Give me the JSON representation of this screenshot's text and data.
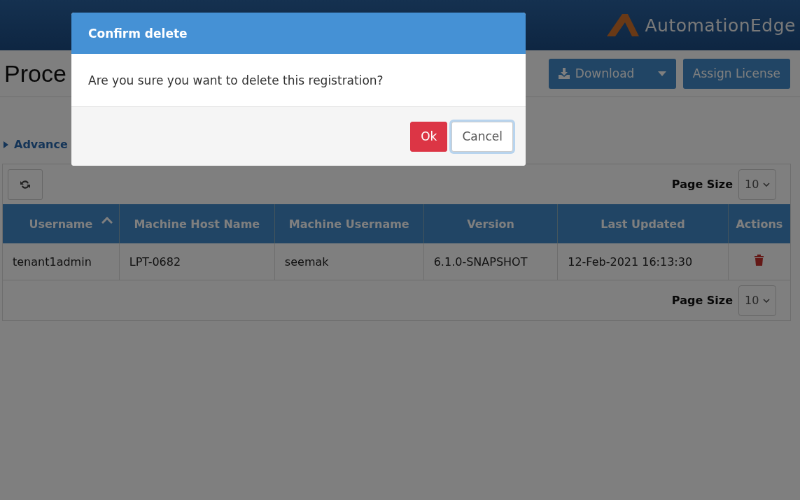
{
  "header": {
    "logo_text": "AutomationEdge"
  },
  "page": {
    "title": "Proce",
    "buttons": [
      {
        "label": "Download",
        "kind": "split"
      },
      {
        "label": "Assign License",
        "kind": "plain"
      }
    ],
    "advanced_toggle": {
      "label": "Advance",
      "expanded": false
    }
  },
  "table": {
    "page_size_label": "Page Size",
    "page_size": "10",
    "columns": [
      {
        "label": "Username",
        "sorted": true
      },
      {
        "label": "Machine Host Name",
        "sorted": false
      },
      {
        "label": "Machine Username",
        "sorted": false
      },
      {
        "label": "Version",
        "sorted": false
      },
      {
        "label": "Last Updated",
        "sorted": false
      },
      {
        "label": "Actions",
        "sorted": false
      }
    ],
    "rows": [
      {
        "cells": [
          "tenant1admin",
          "LPT-0682",
          "seemak",
          "6.1.0-SNAPSHOT",
          "12-Feb-2021 16:13:30"
        ]
      }
    ],
    "footer_page_size_label": "Page Size",
    "footer_page_size": "10"
  },
  "dialog": {
    "title": "Confirm delete",
    "message": "Are you sure you want to delete this registration?",
    "buttons": [
      {
        "label": "Ok",
        "kind": "danger",
        "focused": false
      },
      {
        "label": "Cancel",
        "kind": "default",
        "focused": true
      }
    ]
  }
}
